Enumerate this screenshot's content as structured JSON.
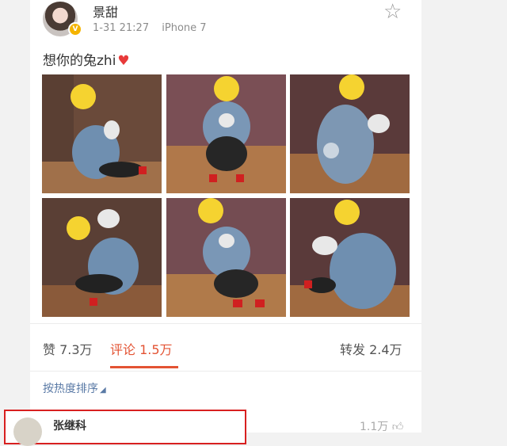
{
  "post": {
    "username": "景甜",
    "timestamp": "1-31 21:27",
    "device": "iPhone 7",
    "text": "想你的兔zhi",
    "heart_icon": "heart-icon",
    "verified_icon": "verified-badge-icon",
    "favorite_icon": "star-outline-icon"
  },
  "photos": [
    {
      "label": "photo-1"
    },
    {
      "label": "photo-2"
    },
    {
      "label": "photo-3"
    },
    {
      "label": "photo-4"
    },
    {
      "label": "photo-5"
    },
    {
      "label": "photo-6"
    }
  ],
  "stats": {
    "likes": "赞 7.3万",
    "comments": "评论 1.5万",
    "reposts": "转发 2.4万",
    "active_tab": "comments",
    "accent_color": "#e35333"
  },
  "comments": {
    "sort_label": "按热度排序",
    "first": {
      "author": "张继科",
      "likes": "1.1万"
    }
  }
}
